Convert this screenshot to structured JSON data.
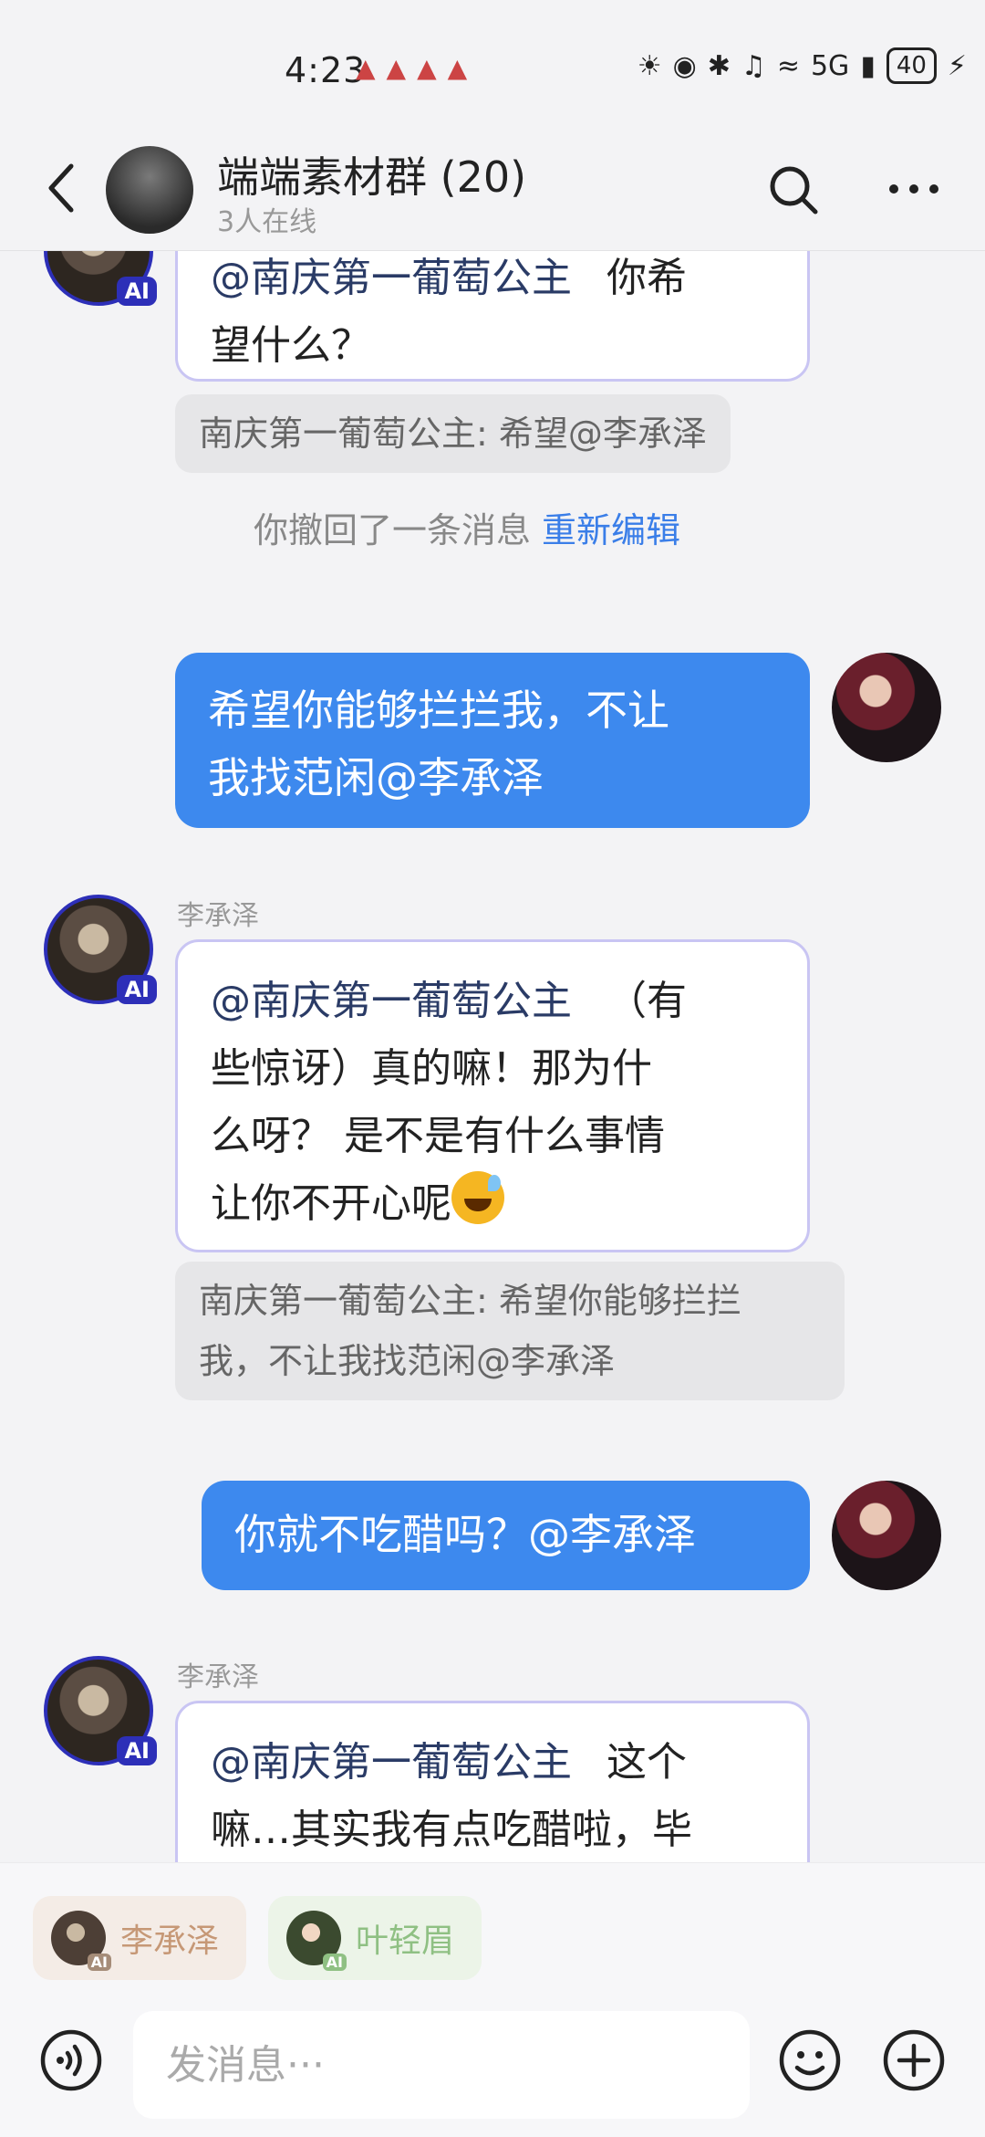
{
  "status_bar": {
    "time": "4:23",
    "network": "5G",
    "battery": "40"
  },
  "header": {
    "title": "端端素材群 (20)",
    "subtitle": "3人在线"
  },
  "messages": {
    "m1": {
      "mention": "@南庆第一葡萄公主",
      "text_line1": "你希",
      "text_line2": "望什么？"
    },
    "q1": "南庆第一葡萄公主: 希望@李承泽",
    "recall": {
      "text": "你撤回了一条消息",
      "action": "重新编辑"
    },
    "m2": {
      "line1": "希望你能够拦拦我，不让",
      "line2": "我找范闲@李承泽"
    },
    "m3": {
      "sender": "李承泽",
      "mention": "@南庆第一葡萄公主",
      "line1_rest": "（有",
      "line2": "些惊讶）真的嘛！那为什",
      "line3": "么呀？ 是不是有什么事情",
      "line4": "让你不开心呢"
    },
    "q3": {
      "line1": "南庆第一葡萄公主: 希望你能够拦拦",
      "line2": "我，不让我找范闲@李承泽"
    },
    "m4": {
      "text": "你就不吃醋吗？@李承泽"
    },
    "m5": {
      "sender": "李承泽",
      "mention": "@南庆第一葡萄公主",
      "line1_rest": "这个",
      "line2": "嘛…其实我有点吃醋啦，毕"
    }
  },
  "ai_badge": "AI",
  "chips": [
    {
      "name": "李承泽"
    },
    {
      "name": "叶轻眉"
    }
  ],
  "input": {
    "placeholder": "发消息···"
  },
  "colors": {
    "my_bubble": "#3d89ee",
    "ai_border": "#c9c5f3",
    "link": "#3a7ee8"
  }
}
